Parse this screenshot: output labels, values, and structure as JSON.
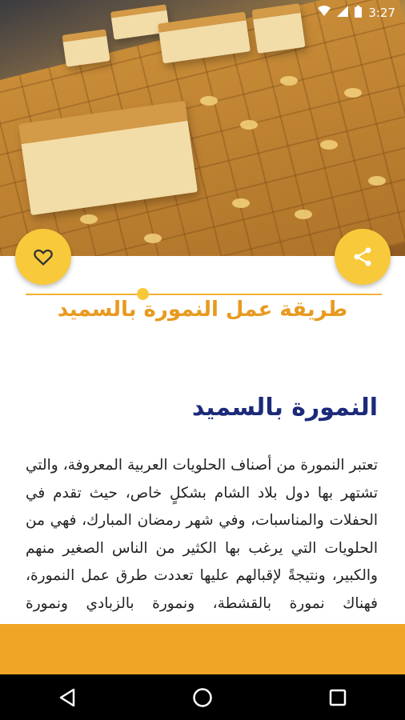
{
  "status_bar": {
    "time": "3:27",
    "icons": [
      "wifi-icon",
      "signal-icon",
      "battery-icon"
    ]
  },
  "hero_image": {
    "description_icon": "namoura-cake-photo"
  },
  "actions": {
    "favorite_icon": "heart-outline-icon",
    "share_icon": "share-icon"
  },
  "colors": {
    "accent": "#f8c93a",
    "title": "#e89a1f",
    "heading": "#1c2a7a",
    "bottom_bar": "#f0a527"
  },
  "recipe": {
    "title": "طريقة عمل النمورة بالسميد",
    "section_title": "النمورة بالسميد",
    "body": "تعتبر النمورة من أصناف الحلويات العربية المعروفة، والتي تشتهر بها دول بلاد الشام بشكلٍ خاص، حيث تقدم في الحفلات والمناسبات، وفي شهر رمضان المبارك، فهي من الحلويات التي يرغب بها الكثير من الناس الصغير منهم والكبير، ونتيجةً لإقبالهم عليها تعددت طرق عمل النمورة، فهناك نمورة بالقشطة، ونمورة بالزبادي ونمورة بالشوكولاتة وغيرها، وفي هذا المقال سنعرفكم على طريقة عمل"
  },
  "nav": {
    "back_icon": "back-triangle-icon",
    "home_icon": "home-circle-icon",
    "recents_icon": "recents-square-icon"
  }
}
